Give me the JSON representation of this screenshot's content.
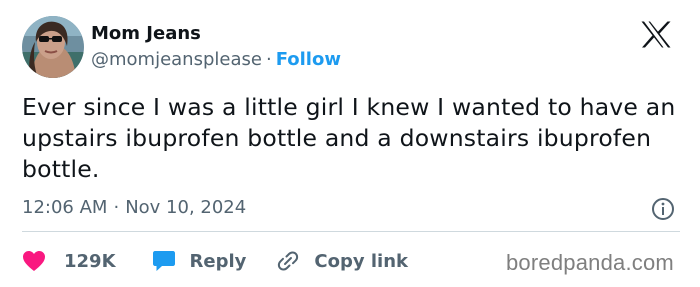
{
  "tweet": {
    "author_name": "Mom Jeans",
    "handle": "@momjeansplease",
    "separator": "·",
    "follow_label": "Follow",
    "text": "Ever since I was a little girl I knew I wanted to have an upstairs ibuprofen bottle and a downstairs ibuprofen bottle.",
    "time": "12:06 AM",
    "date": "Nov 10, 2024"
  },
  "actions": {
    "like_count": "129K",
    "reply_label": "Reply",
    "copy_label": "Copy link"
  },
  "watermark": "boredpanda.com",
  "icons": {
    "platform": "x-logo-icon",
    "info": "info-icon",
    "like": "heart-icon",
    "reply": "speech-bubble-icon",
    "copy": "link-icon"
  },
  "colors": {
    "accent": "#1d9bf0",
    "like": "#f91880",
    "text_primary": "#0f1419",
    "text_secondary": "#536471",
    "divider": "#cfd9de"
  }
}
